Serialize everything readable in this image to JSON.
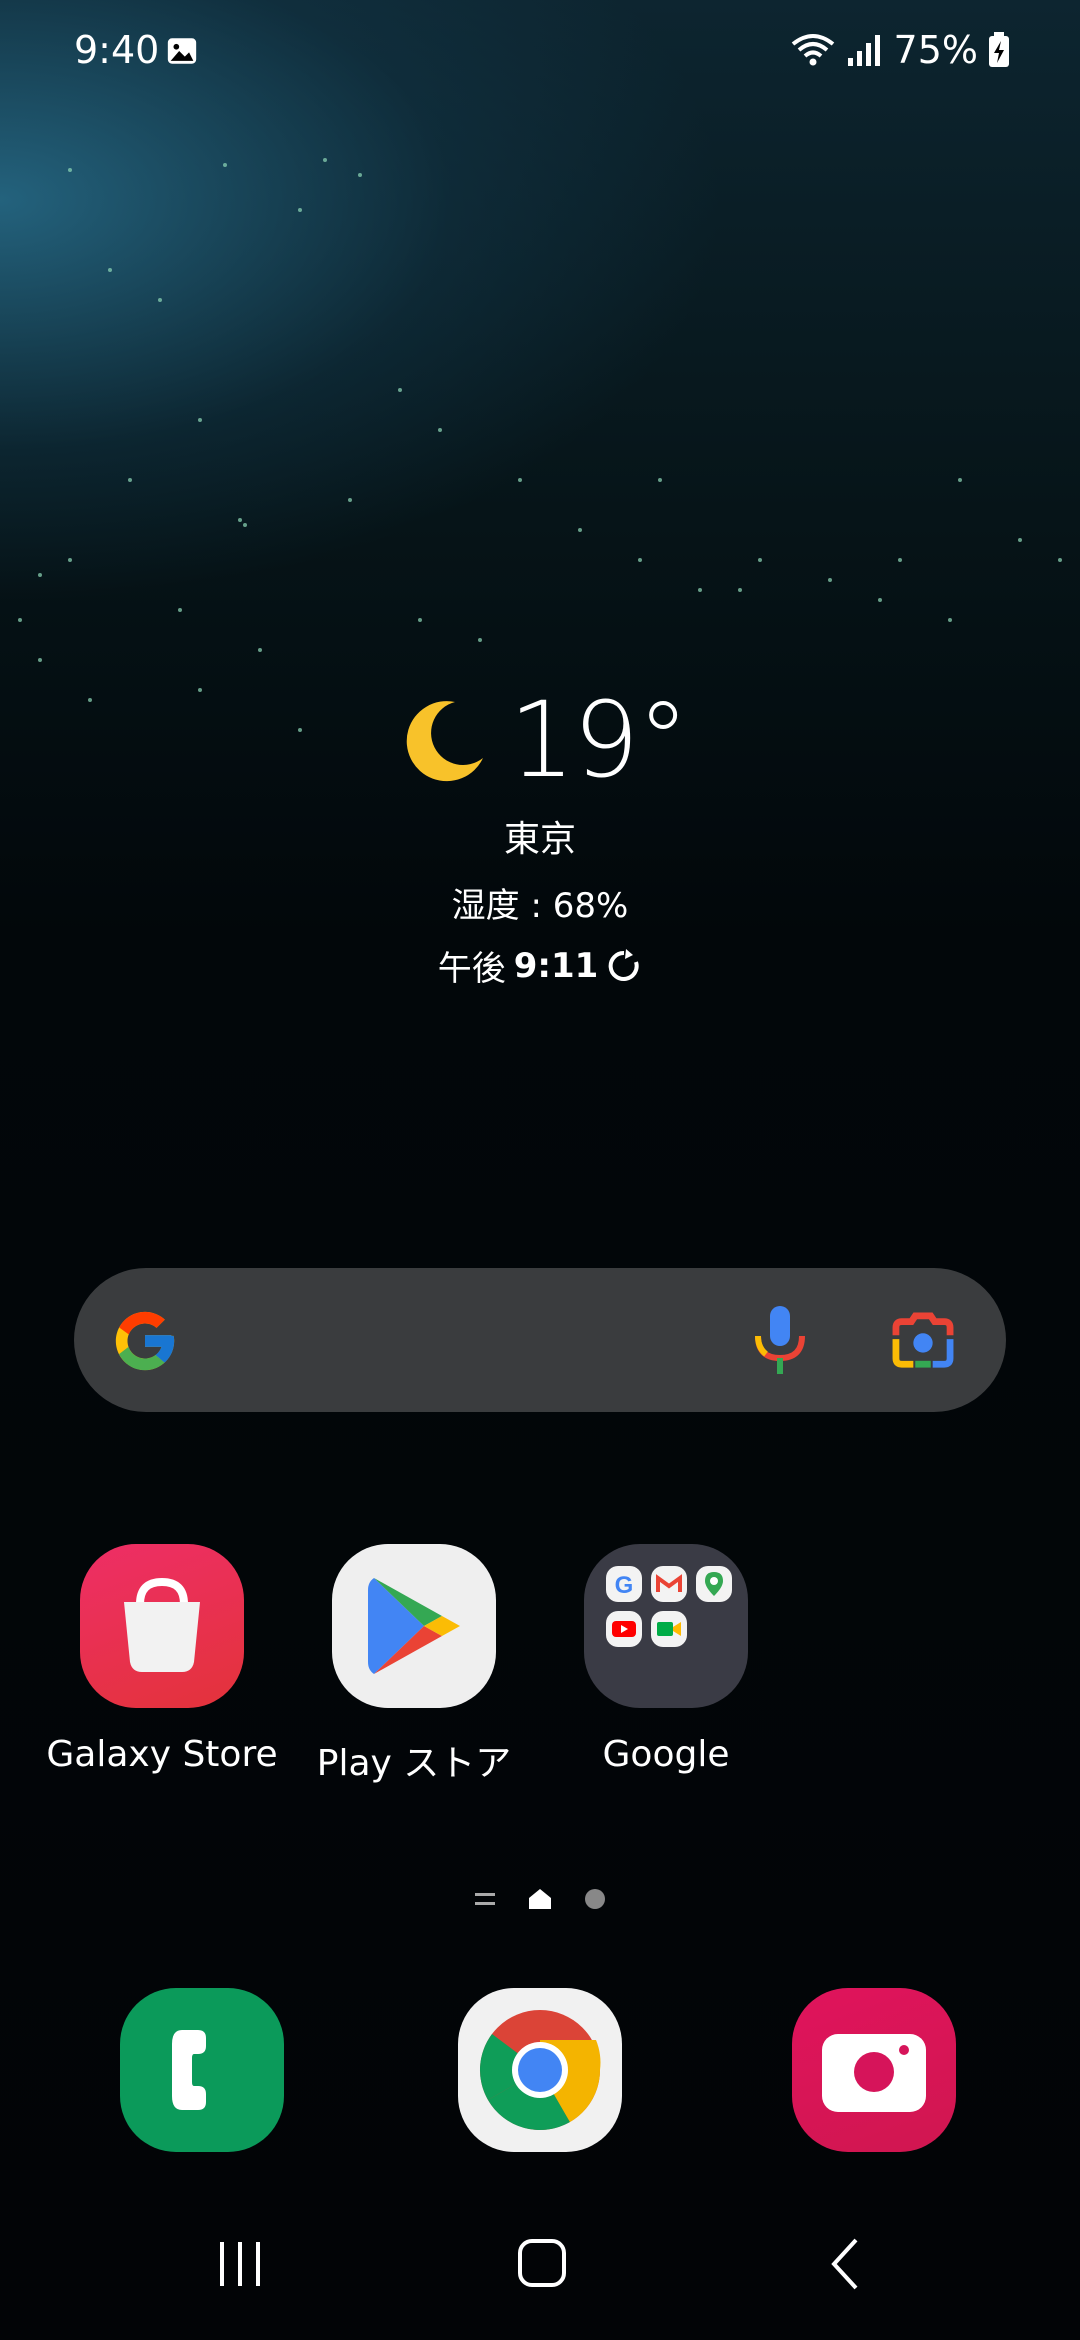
{
  "status_bar": {
    "time": "9:40",
    "battery_percent": "75%",
    "icons": [
      "image-icon",
      "wifi-icon",
      "signal-icon",
      "battery-charging-icon"
    ]
  },
  "weather": {
    "icon": "moon-icon",
    "temperature": "19°",
    "city": "東京",
    "humidity": "湿度 : 68%",
    "updated_prefix": "午後",
    "updated_time": "9:11",
    "refresh_icon": "refresh-icon"
  },
  "search_bar": {
    "icons": [
      "google-g-icon",
      "mic-icon",
      "google-lens-icon"
    ]
  },
  "apps": [
    {
      "label": "Galaxy Store",
      "icon": "galaxy-store-icon",
      "color": "#e8264f"
    },
    {
      "label": "Play ストア",
      "icon": "play-store-icon",
      "color": "#efefef"
    },
    {
      "label": "Google",
      "icon": "google-folder-icon",
      "color": "#3a3b45"
    }
  ],
  "pager": {
    "pages": [
      "menu-page",
      "home-page",
      "page-2"
    ],
    "active": "home-page"
  },
  "dock": [
    {
      "icon": "phone-icon",
      "color": "#0b9a5a"
    },
    {
      "icon": "chrome-icon",
      "color": "#f1f1f1"
    },
    {
      "icon": "camera-icon",
      "color": "#d6145a"
    }
  ],
  "nav_bar": {
    "buttons": [
      "recents-button",
      "home-button",
      "back-button"
    ]
  }
}
